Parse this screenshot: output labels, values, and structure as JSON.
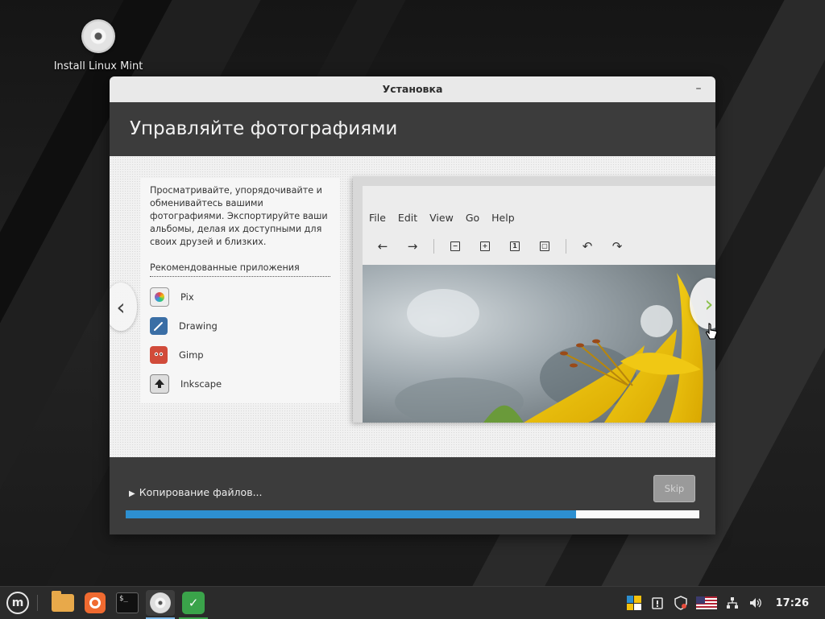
{
  "desktop": {
    "icon_label": "Install Linux Mint"
  },
  "window": {
    "title": "Установка",
    "minimize_symbol": "–",
    "header": "Управляйте фотографиями",
    "description": "Просматривайте, упорядочивайте и обменивайтесь вашими фотографиями. Экспортируйте ваши альбомы, делая их доступными для своих друзей и близких.",
    "recommended_title": "Рекомендованные приложения",
    "apps": [
      {
        "name": "Pix",
        "icon": "pix-icon"
      },
      {
        "name": "Drawing",
        "icon": "drawing-icon"
      },
      {
        "name": "Gimp",
        "icon": "gimp-icon"
      },
      {
        "name": "Inkscape",
        "icon": "inkscape-icon"
      }
    ],
    "preview_menu": [
      "File",
      "Edit",
      "View",
      "Go",
      "Help"
    ],
    "preview_zoom_labels": [
      "−",
      "+",
      "1",
      "▢"
    ],
    "nav_prev": "‹",
    "nav_next": "›",
    "status_text": "Копирование файлов...",
    "skip_label": "Skip",
    "progress": 0.785
  },
  "taskbar": {
    "menu_letter": "m",
    "terminal_text": "$_",
    "clock": "17:26"
  },
  "colors": {
    "accent": "#2d8fd0",
    "mint_green": "#8cc14c",
    "window_dark": "#3c3c3c"
  }
}
